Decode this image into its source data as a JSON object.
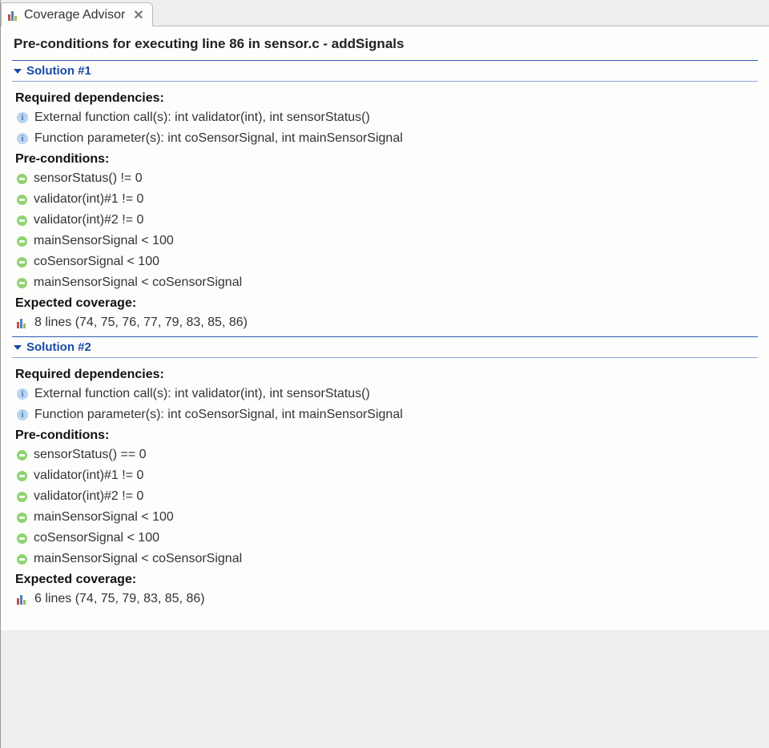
{
  "tab": {
    "title": "Coverage Advisor"
  },
  "title": "Pre-conditions for executing line 86 in sensor.c - addSignals",
  "labels": {
    "reqDeps": "Required dependencies:",
    "preConds": "Pre-conditions:",
    "expCov": "Expected coverage:"
  },
  "solutions": [
    {
      "header": "Solution #1",
      "dependencies": [
        "External function call(s): int validator(int), int sensorStatus()",
        "Function parameter(s): int coSensorSignal, int mainSensorSignal"
      ],
      "preconditions": [
        "sensorStatus() != 0",
        "validator(int)#1 != 0",
        "validator(int)#2 != 0",
        "mainSensorSignal < 100",
        "coSensorSignal < 100",
        "mainSensorSignal < coSensorSignal"
      ],
      "coverage": "8 lines (74, 75, 76, 77, 79, 83, 85, 86)"
    },
    {
      "header": "Solution #2",
      "dependencies": [
        "External function call(s): int validator(int), int sensorStatus()",
        "Function parameter(s): int coSensorSignal, int mainSensorSignal"
      ],
      "preconditions": [
        "sensorStatus() == 0",
        "validator(int)#1 != 0",
        "validator(int)#2 != 0",
        "mainSensorSignal < 100",
        "coSensorSignal < 100",
        "mainSensorSignal < coSensorSignal"
      ],
      "coverage": "6 lines (74, 75, 79, 83, 85, 86)"
    }
  ]
}
